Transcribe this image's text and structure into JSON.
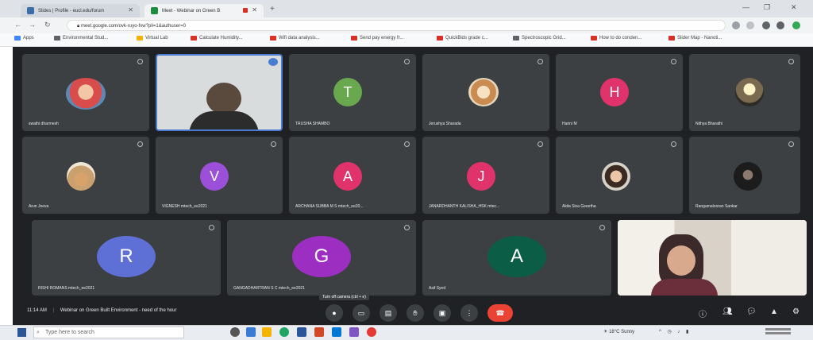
{
  "browser": {
    "tabs": [
      {
        "label": "Slides | Profile - eucl.edu/forum",
        "active": false
      },
      {
        "label": "Meet - Webinar on Green B",
        "active": true
      }
    ],
    "url": "meet.google.com/ovk-ruyo-fxw?pli=1&authuser=0",
    "bookmarks": [
      "Apps",
      "Environmental Stud...",
      "Virtual Lab",
      "Calculate Humidity...",
      "Wifi data analysis...",
      "Send pay energy fr...",
      "QuickBids grade c...",
      "Spectroscopic Grid...",
      "How to do conden...",
      "Slider Map - Nanoti..."
    ]
  },
  "meeting": {
    "participants_row1": [
      {
        "name": "swathi dharmesh",
        "type": "photo"
      },
      {
        "name": "",
        "type": "video"
      },
      {
        "name": "TRUSHA SHAMBO",
        "type": "avatar",
        "initial": "T",
        "color": "#6aa84f"
      },
      {
        "name": "Jerushya Sharada",
        "type": "photo"
      },
      {
        "name": "Harini M",
        "type": "avatar",
        "initial": "H",
        "color": "#e0336b"
      },
      {
        "name": "Nithya Bharathi",
        "type": "photo"
      }
    ],
    "participants_row2": [
      {
        "name": "Arun Jeeva",
        "type": "photo"
      },
      {
        "name": "VIGNESH mtech_ee2021",
        "type": "avatar",
        "initial": "V",
        "color": "#9c4fd8"
      },
      {
        "name": "ARCHANA SUBBA M S mtech_ee20...",
        "type": "avatar",
        "initial": "A",
        "color": "#e0336b"
      },
      {
        "name": "JANARDHANTH KALISHA_HSK mtec...",
        "type": "avatar",
        "initial": "J",
        "color": "#e0336b"
      },
      {
        "name": "Akila Siva Geeetha",
        "type": "photo"
      },
      {
        "name": "Rangamalooran Sankar",
        "type": "photo"
      }
    ],
    "participants_row3": [
      {
        "name": "RISHI ROMANS mtech_ee2021",
        "type": "avatar",
        "initial": "R",
        "color": "#5e6fd6"
      },
      {
        "name": "GANGADHARTRAN S C mtech_ee2021",
        "type": "avatar",
        "initial": "G",
        "color": "#9c2fc2"
      },
      {
        "name": "Asif Syed",
        "type": "avatar",
        "initial": "A",
        "color": "#0b5e45"
      },
      {
        "name": "",
        "type": "video"
      }
    ],
    "time": "11:14 AM",
    "title": "Webinar on Green Built Environment - need of the hour",
    "tooltip": "Turn off camera (ctrl + e)"
  },
  "taskbar": {
    "search_placeholder": "Type here to search",
    "tray_text": "18°C Sunny"
  }
}
